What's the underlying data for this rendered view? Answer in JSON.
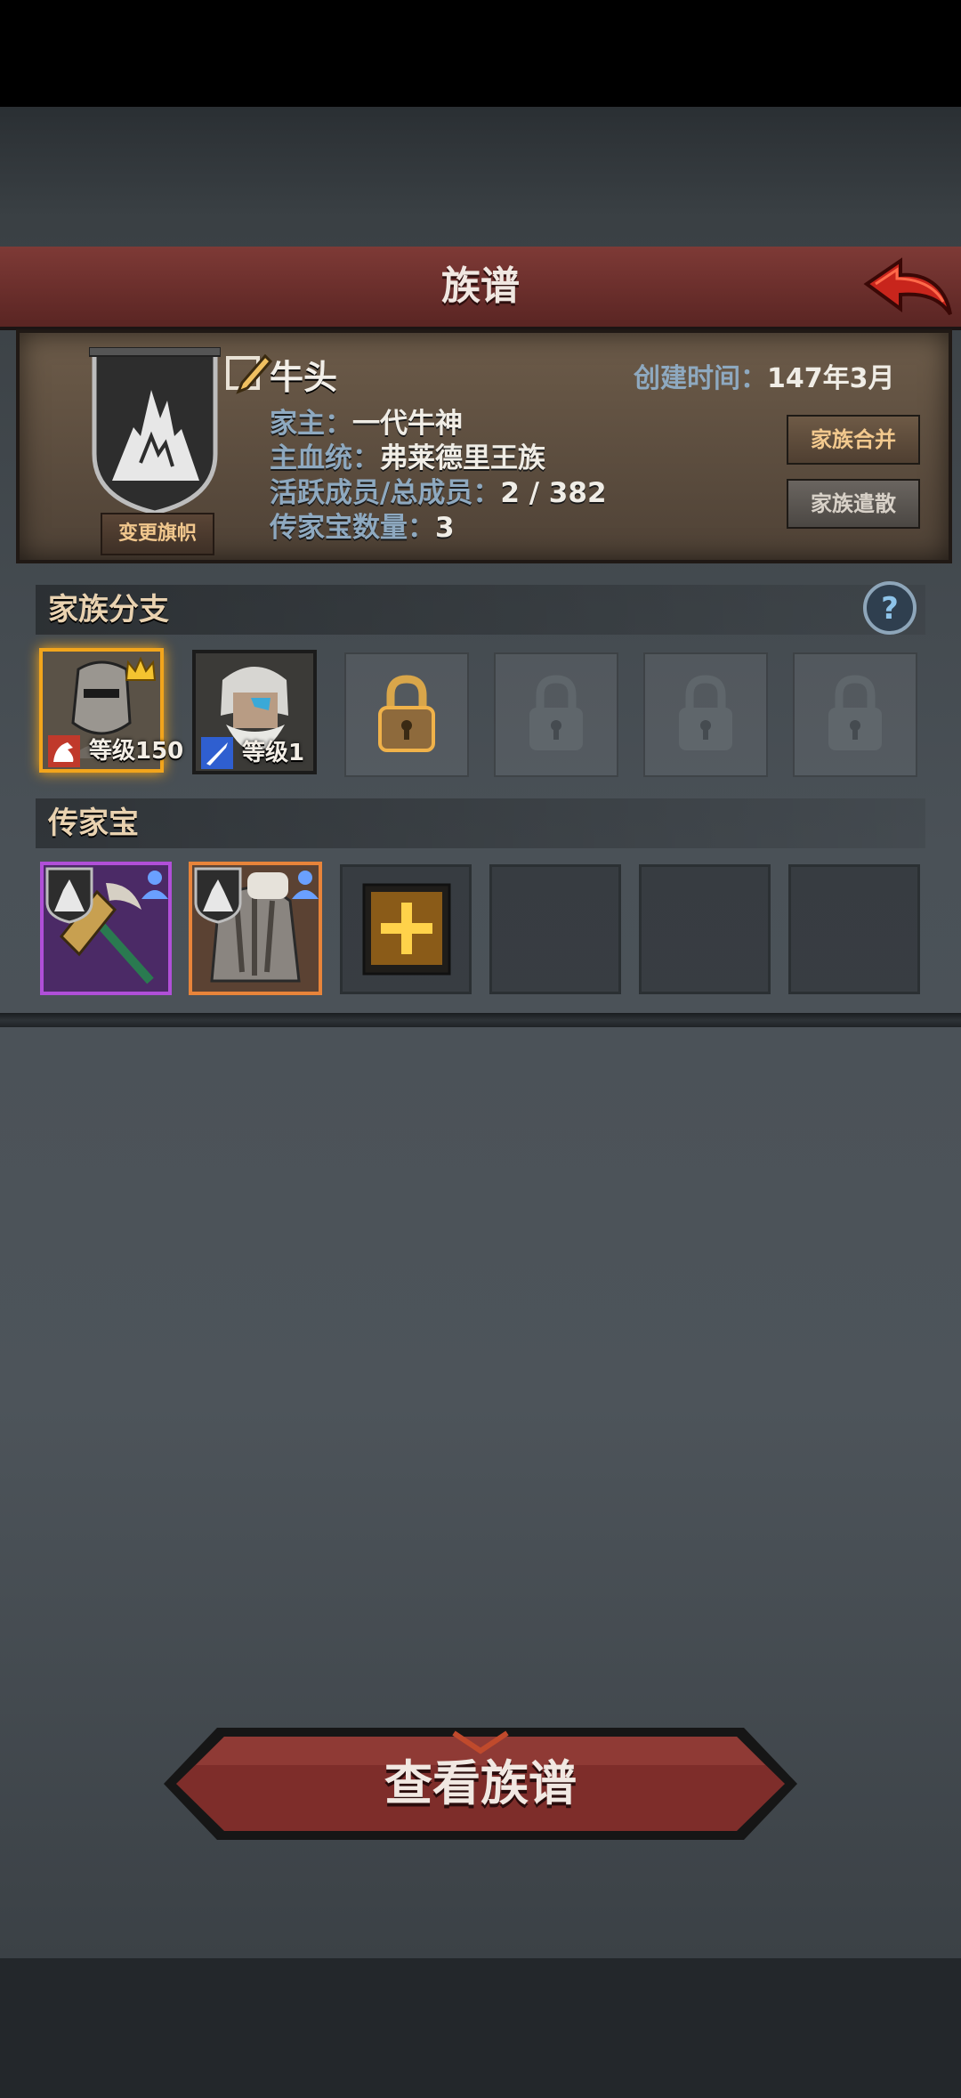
{
  "header": {
    "title": "族谱"
  },
  "family": {
    "name": "牛头",
    "created_label": "创建时间：",
    "created_value": "147年3月",
    "head_label": "家主：",
    "head_value": "一代牛神",
    "bloodline_label": "主血统：",
    "bloodline_value": "弗莱德里王族",
    "members_label": "活跃成员/总成员：",
    "members_value": "2 / 382",
    "heirloom_count_label": "传家宝数量：",
    "heirloom_count_value": "3",
    "change_flag_label": "变更旗帜",
    "merge_label": "家族合并",
    "disband_label": "家族遣散"
  },
  "branches": {
    "title": "家族分支",
    "members": [
      {
        "level_text": "等级150",
        "frame_color": "#f2a51c"
      },
      {
        "level_text": "等级1",
        "frame_color": "#1b1b1b"
      }
    ],
    "locked_slots": 4
  },
  "heirlooms": {
    "title": "传家宝",
    "items": [
      {
        "name": "hammer",
        "frame_color": "#b04fd8"
      },
      {
        "name": "tree-armor",
        "frame_color": "#e8843a"
      }
    ],
    "empty_slots": 3
  },
  "footer": {
    "view_button_label": "查看族谱"
  }
}
